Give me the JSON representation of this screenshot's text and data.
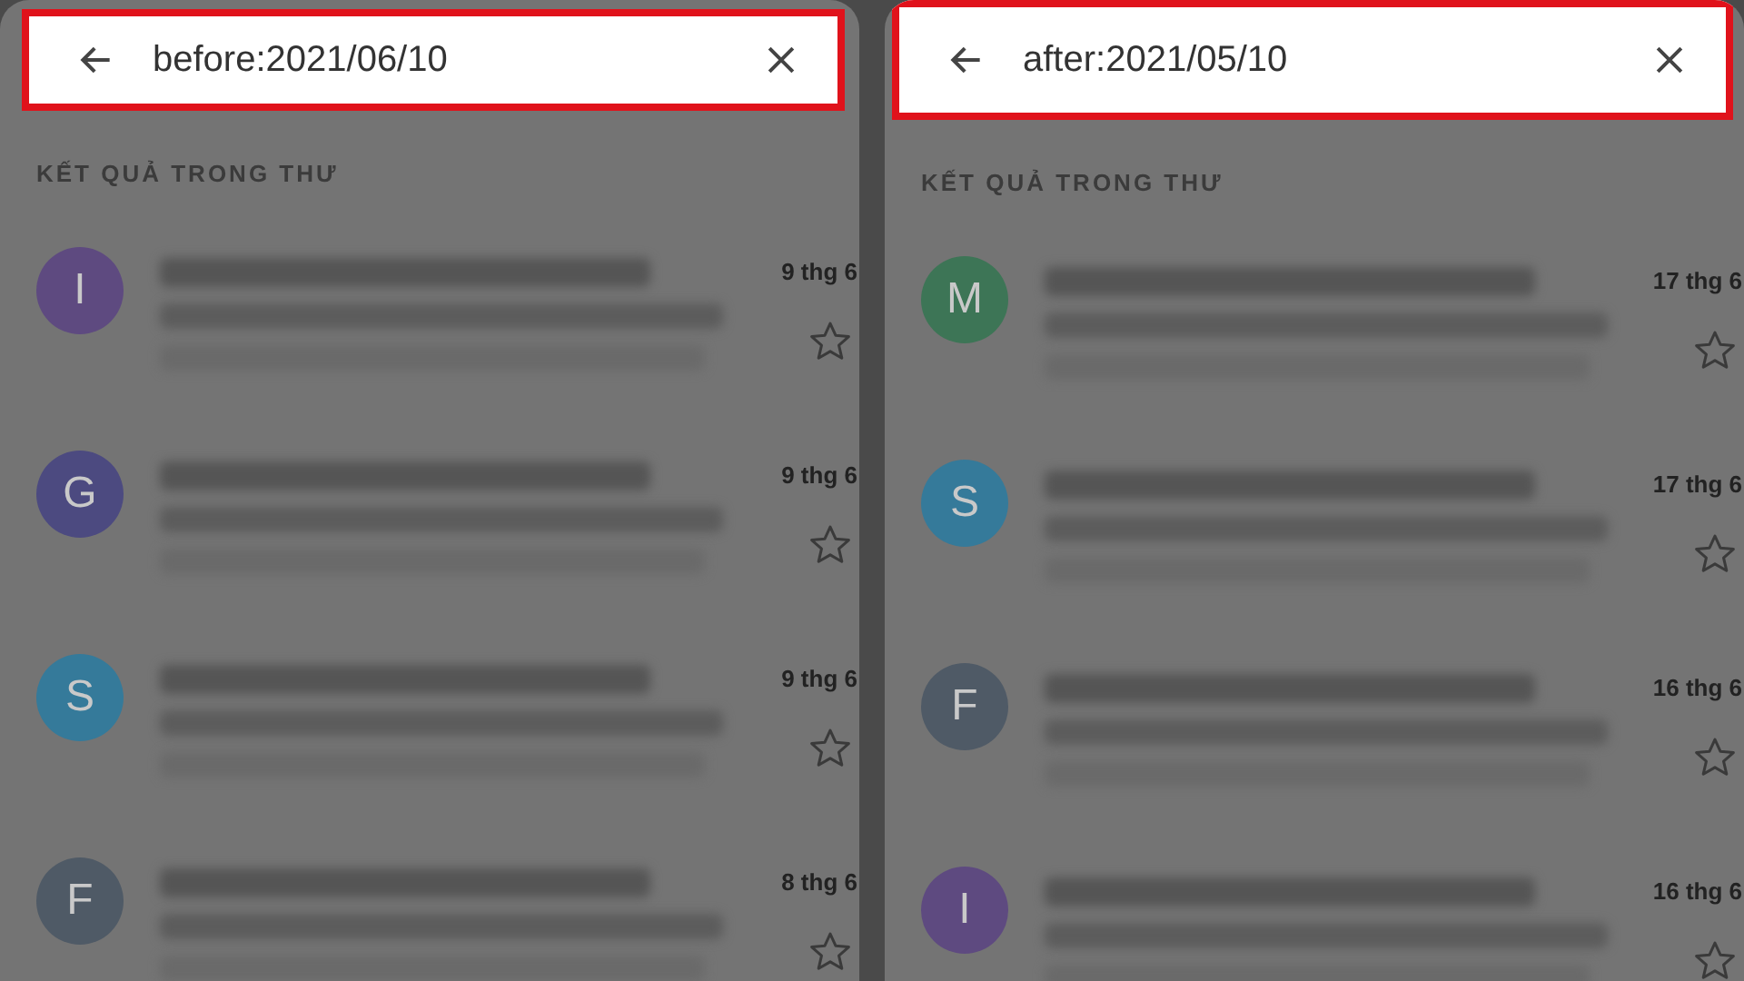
{
  "panels": [
    {
      "search": {
        "value": "before:2021/06/10"
      },
      "section_title": "KẾT QUẢ TRONG THƯ",
      "messages": [
        {
          "initial": "I",
          "color": "#5e4a80",
          "date": "9 thg 6"
        },
        {
          "initial": "G",
          "color": "#4c4a80",
          "date": "9 thg 6"
        },
        {
          "initial": "S",
          "color": "#357a9a",
          "date": "9 thg 6"
        },
        {
          "initial": "F",
          "color": "#4f5a66",
          "date": "8 thg 6"
        }
      ]
    },
    {
      "search": {
        "value": "after:2021/05/10"
      },
      "section_title": "KẾT QUẢ TRONG THƯ",
      "messages": [
        {
          "initial": "M",
          "color": "#3d7556",
          "date": "17 thg 6"
        },
        {
          "initial": "S",
          "color": "#357a9a",
          "date": "17 thg 6"
        },
        {
          "initial": "F",
          "color": "#4f5a66",
          "date": "16 thg 6"
        },
        {
          "initial": "I",
          "color": "#5e4a80",
          "date": "16 thg 6"
        }
      ]
    }
  ]
}
